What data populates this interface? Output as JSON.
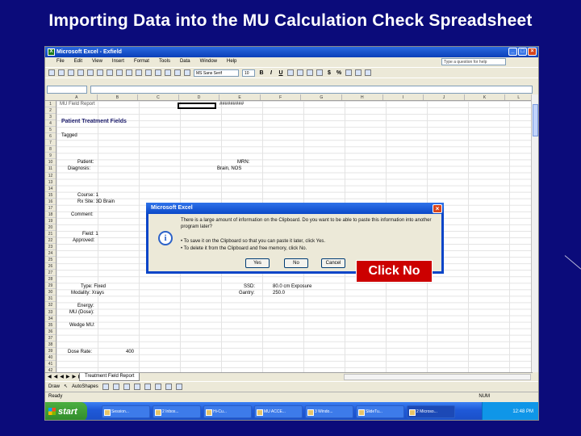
{
  "slide": {
    "title": "Importing Data into the MU Calculation Check Spreadsheet"
  },
  "excel": {
    "window_title": "Microsoft Excel - Exfield",
    "menu": [
      "File",
      "Edit",
      "View",
      "Insert",
      "Format",
      "Tools",
      "Data",
      "Window",
      "Help"
    ],
    "help_placeholder": "Type a question for help",
    "font_name": "MS Sans Serif",
    "font_size": "10",
    "columns": [
      "A",
      "B",
      "C",
      "D",
      "E",
      "F",
      "G",
      "H",
      "I",
      "J",
      "K",
      "L"
    ],
    "rows": [
      "1",
      "2",
      "3",
      "4",
      "5",
      "6",
      "7",
      "8",
      "9",
      "10",
      "11",
      "12",
      "13",
      "14",
      "15",
      "16",
      "17",
      "18",
      "19",
      "20",
      "21",
      "22",
      "23",
      "24",
      "25",
      "26",
      "27",
      "28",
      "29",
      "30",
      "31",
      "32",
      "33",
      "34",
      "35",
      "36",
      "37",
      "38",
      "39",
      "40",
      "41",
      "42"
    ],
    "cells": {
      "r1": "#########",
      "patient_treatment_fields": "Patient Treatment Fields",
      "tagged": "Tagged",
      "patient": "Patient:",
      "mrn": "MRN:",
      "diagnosis": "Diagnosis:",
      "diagnosis_value": "Brain, NOS",
      "course": "Course: 1",
      "rx_site": "Rx Site: 3D Brain",
      "comment": "Comment:",
      "field": "Field: 1",
      "approved": "Approved:",
      "type": "Type: Fixed",
      "modality": "Modality: Xrays",
      "ssd": "SSD:",
      "ssd_value": "80.0 cm Exposure",
      "gantry": "Gantry:",
      "gantry_value": "250.0",
      "energy": "Energy:",
      "mu_dose": "MU (Dose):",
      "wedge_mu": "Wedge MU:",
      "dose_rate": "Dose Rate:",
      "dose_rate_value": "400"
    },
    "sheet_tab": "Treatment Field Report",
    "draw_menu": "Draw",
    "autoshapes": "AutoShapes",
    "status": "Ready",
    "status_right": "NUM"
  },
  "dialog": {
    "title": "Microsoft Excel",
    "message": "There is a large amount of information on the Clipboard. Do you want to be able to paste this information into another program later?",
    "bullet1": "• To save it on the Clipboard so that you can paste it later, click Yes.",
    "bullet2": "• To delete it from the Clipboard and free memory, click No.",
    "btn_yes": "Yes",
    "btn_no": "No",
    "btn_cancel": "Cancel",
    "close": "×"
  },
  "callout": {
    "label": "Click No",
    "color": "#cc0000"
  },
  "taskbar": {
    "start": "start",
    "tasks": [
      "Session...",
      "2 Inbox...",
      "Hi-Cu...",
      "MU ACCE...",
      "3 Windo...",
      "SlideTu...",
      "2 Microso..."
    ],
    "tray": "12:48 PM"
  }
}
